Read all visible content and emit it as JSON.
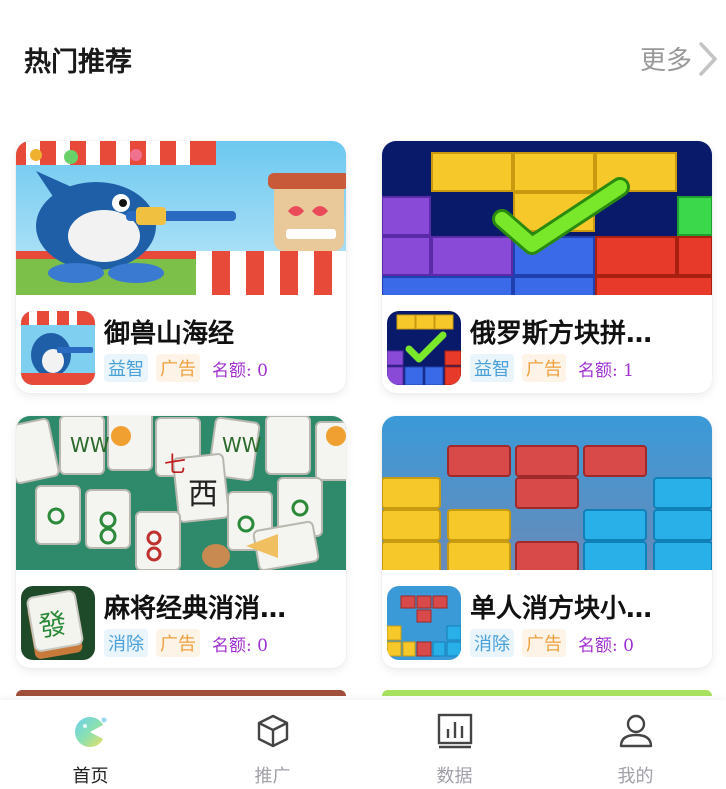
{
  "section": {
    "title": "热门推荐",
    "more_label": "更多"
  },
  "games": [
    {
      "name": "御兽山海经",
      "category": "益智",
      "ad_tag": "广告",
      "quota": "名额: 0",
      "banner": "carnival-shark-art"
    },
    {
      "name": "俄罗斯方块拼…",
      "category": "益智",
      "ad_tag": "广告",
      "quota": "名额: 1",
      "banner": "block-puzzle-checkmark-art"
    },
    {
      "name": "麻将经典消消…",
      "category": "消除",
      "ad_tag": "广告",
      "quota": "名额: 0",
      "banner": "mahjong-tiles-art"
    },
    {
      "name": "单人消方块小…",
      "category": "消除",
      "ad_tag": "广告",
      "quota": "名额: 0",
      "banner": "color-blocks-art"
    }
  ],
  "tabbar": {
    "items": [
      {
        "label": "首页",
        "icon": "home-planet-icon",
        "active": true
      },
      {
        "label": "推广",
        "icon": "cube-icon",
        "active": false
      },
      {
        "label": "数据",
        "icon": "bar-chart-icon",
        "active": false
      },
      {
        "label": "我的",
        "icon": "user-icon",
        "active": false
      }
    ]
  },
  "colors": {
    "category_text": "#4aa0d8",
    "ad_text": "#f0a040",
    "quota_text": "#a030d0",
    "tab_active": "#222222",
    "tab_inactive": "#a0a0a8"
  }
}
